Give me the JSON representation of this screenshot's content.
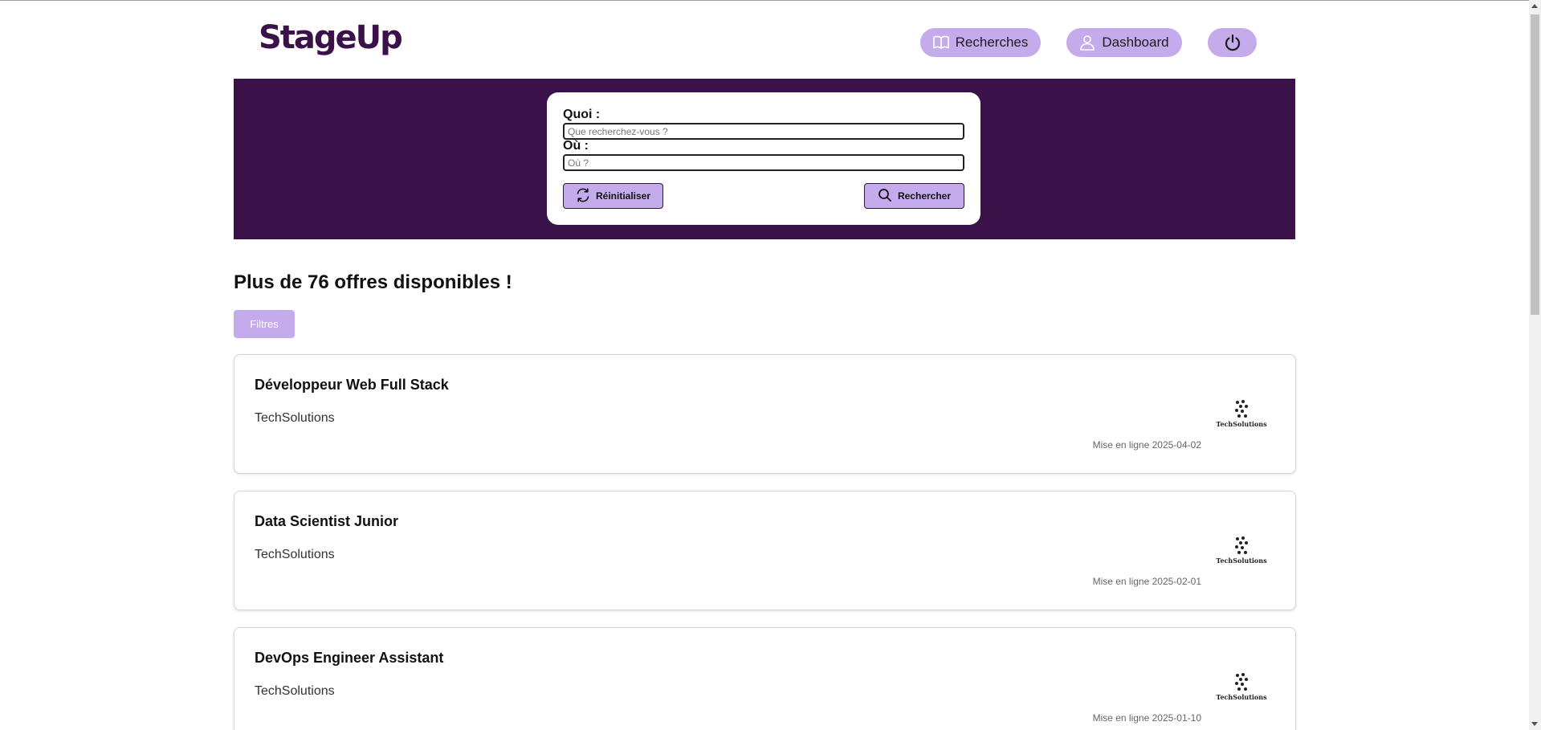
{
  "app": {
    "logo_text": "StageUp"
  },
  "nav": {
    "recherches_label": "Recherches",
    "dashboard_label": "Dashboard"
  },
  "search": {
    "quoi_label": "Quoi :",
    "quoi_placeholder": "Que recherchez-vous ?",
    "ou_label": "Où :",
    "ou_placeholder": "Où ?",
    "reset_label": "Réinitialiser",
    "search_label": "Rechercher"
  },
  "results": {
    "title": "Plus de 76 offres disponibles !",
    "filter_label": "Filtres"
  },
  "offers": [
    {
      "title": "Développeur Web Full Stack",
      "company": "TechSolutions",
      "date": "Mise en ligne 2025-04-02",
      "logo_text": "TechSolutions"
    },
    {
      "title": "Data Scientist Junior",
      "company": "TechSolutions",
      "date": "Mise en ligne 2025-02-01",
      "logo_text": "TechSolutions"
    },
    {
      "title": "DevOps Engineer Assistant",
      "company": "TechSolutions",
      "date": "Mise en ligne 2025-01-10",
      "logo_text": "TechSolutions"
    }
  ],
  "colors": {
    "brand_dark": "#3a1149",
    "accent_lavender": "#c6abec"
  }
}
